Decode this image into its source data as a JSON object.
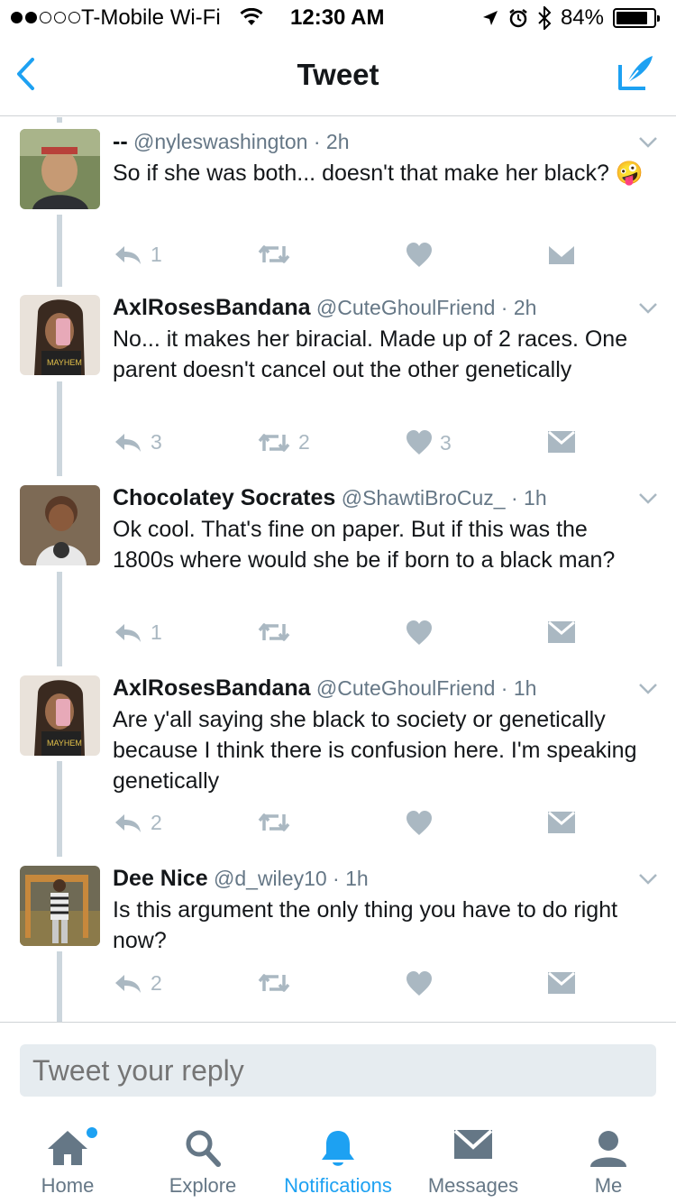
{
  "status_bar": {
    "carrier": "T-Mobile Wi-Fi",
    "time": "12:30 AM",
    "battery": "84%",
    "battery_level": 0.84,
    "signal_bars": 2
  },
  "nav": {
    "title": "Tweet",
    "back_icon": "chevron-left-icon",
    "compose_icon": "compose-quill-icon"
  },
  "colors": {
    "accent": "#1da1f2",
    "icon_gray": "#aab8c2",
    "thread_line": "#ccd6dd"
  },
  "tweets": [
    {
      "name": "--",
      "handle": "@nyleswashington",
      "time": "2h",
      "text": "So if she was both... doesn't that make her black? 🤪",
      "reply_count": "1",
      "retweet_count": "",
      "like_count": ""
    },
    {
      "name": "AxlRosesBandana",
      "handle": "@CuteGhoulFriend",
      "time": "2h",
      "text": "No... it makes her biracial. Made up of 2 races. One parent doesn't cancel out the other genetically",
      "reply_count": "3",
      "retweet_count": "2",
      "like_count": "3"
    },
    {
      "name": "Chocolatey Socrates",
      "handle": "@ShawtiBroCuz_",
      "time": "1h",
      "text": "Ok cool. That's fine on paper. But if this was the 1800s where would she be if born to a black man?",
      "reply_count": "1",
      "retweet_count": "",
      "like_count": ""
    },
    {
      "name": "AxlRosesBandana",
      "handle": "@CuteGhoulFriend",
      "time": "1h",
      "text": "Are y'all saying she black to society or genetically because I think there is confusion here. I'm speaking genetically",
      "reply_count": "2",
      "retweet_count": "",
      "like_count": ""
    },
    {
      "name": "Dee Nice",
      "handle": "@d_wiley10",
      "time": "1h",
      "text": "Is this argument the only thing you have to do right now?",
      "reply_count": "2",
      "retweet_count": "",
      "like_count": ""
    }
  ],
  "reply": {
    "placeholder": "Tweet your reply"
  },
  "tabs": [
    {
      "label": "Home",
      "icon": "home-icon",
      "active": false
    },
    {
      "label": "Explore",
      "icon": "search-icon",
      "active": false
    },
    {
      "label": "Notifications",
      "icon": "bell-icon",
      "active": true
    },
    {
      "label": "Messages",
      "icon": "envelope-icon",
      "active": false
    },
    {
      "label": "Me",
      "icon": "person-icon",
      "active": false
    }
  ]
}
